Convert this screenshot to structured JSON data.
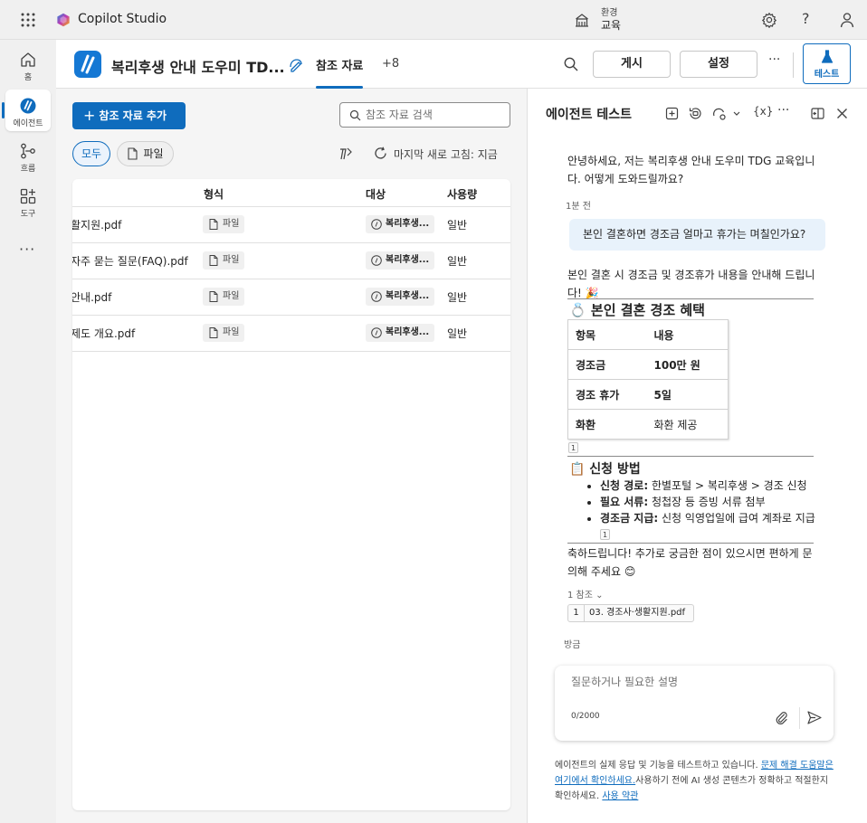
{
  "topbar": {
    "brand": "Copilot Studio",
    "env_label": "환경",
    "env_value": "교육",
    "help": "?"
  },
  "rail": {
    "items": [
      {
        "label": "홈",
        "icon": "home-icon"
      },
      {
        "label": "에이전트",
        "icon": "agent-icon"
      },
      {
        "label": "흐름",
        "icon": "flow-icon"
      },
      {
        "label": "도구",
        "icon": "tools-icon"
      }
    ],
    "more": "···"
  },
  "agent_header": {
    "name": "복리후생 안내 도우미 TD...",
    "tab_active": "참조 자료",
    "tab_more": "+8",
    "publish": "게시",
    "settings": "설정",
    "more": "···",
    "test": "테스트"
  },
  "knowledge": {
    "add_button": "참조 자료 추가",
    "search_placeholder": "참조 자료 검색",
    "filters": [
      "모두",
      "파일"
    ],
    "refresh_text": "마지막 새로 고침: 지금",
    "columns": [
      "형식",
      "대상",
      "사용량"
    ],
    "rows": [
      {
        "name": "활지원.pdf",
        "type": "파일",
        "target": "복리후생...",
        "usage": "일반"
      },
      {
        "name": "자주 묻는 질문(FAQ).pdf",
        "type": "파일",
        "target": "복리후생...",
        "usage": "일반"
      },
      {
        "name": "안내.pdf",
        "type": "파일",
        "target": "복리후생...",
        "usage": "일반"
      },
      {
        "name": "제도 개요.pdf",
        "type": "파일",
        "target": "복리후생...",
        "usage": "일반"
      }
    ]
  },
  "test_panel": {
    "title": "에이전트 테스트",
    "var_label": "{x}",
    "more": "···",
    "greeting": "안녕하세요, 저는 복리후생 안내 도우미 TDG 교육입니다. 어떻게 도와드릴까요?",
    "greeting_time": "1분 전",
    "user_message": "본인 결혼하면 경조금 얼마고 휴가는 며칠인가요?",
    "reply_intro": "본인 결혼 시 경조금 및 경조휴가 내용을 안내해 드립니다! 🎉",
    "section1_title": "💍 본인 결혼 경조 혜택",
    "table": [
      [
        "항목",
        "내용"
      ],
      [
        "경조금",
        "100만 원"
      ],
      [
        "경조 휴가",
        "5일"
      ],
      [
        "화환",
        "화환 제공"
      ]
    ],
    "citation": "1",
    "section2_title": "📋 신청 방법",
    "steps": [
      {
        "label": "신청 경로:",
        "text": "한별포털 > 복리후생 > 경조 신청"
      },
      {
        "label": "필요 서류:",
        "text": "청첩장 등 증빙 서류 첨부"
      },
      {
        "label": "경조금 지급:",
        "text": "신청 익영업일에 급여 계좌로 지급"
      }
    ],
    "closing": "축하드립니다! 추가로 궁금한 점이 있으시면 편하게 문의해 주세요 😊",
    "refs_label": "1 참조",
    "ref_number": "1",
    "ref_name": "03. 경조사·생활지원.pdf",
    "reply_time": "방금",
    "input_placeholder": "질문하거나 필요한 설명",
    "counter": "0/2000",
    "disclaimer_pre": "에이전트의 실제 응답 및 기능을 테스트하고 있습니다. ",
    "disclaimer_link1": "문제 해결 도움말은 여기에서 확인하세요.",
    "disclaimer_mid": "사용하기 전에 AI 생성 콘텐츠가 정확하고 적절한지 확인하세요. ",
    "disclaimer_link2": "사용 약관"
  },
  "colors": {
    "accent": "#0f6cbd",
    "user_bubble": "#e8f2fb"
  }
}
